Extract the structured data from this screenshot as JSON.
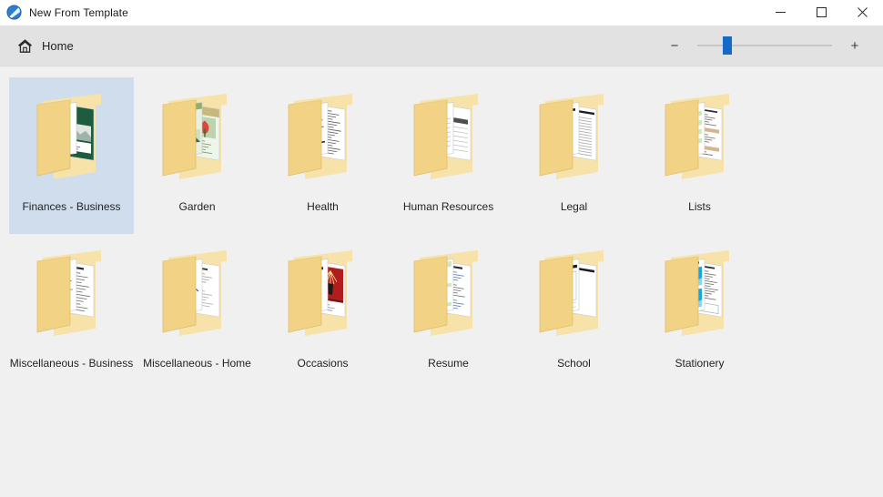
{
  "window": {
    "title": "New From Template",
    "app_icon": "document-globe-icon",
    "controls": {
      "minimize": "minimize-icon",
      "maximize": "maximize-icon",
      "close": "close-icon"
    }
  },
  "toolbar": {
    "home_label": "Home",
    "home_icon": "home-icon",
    "zoom_out_label": "−",
    "zoom_in_label": "+",
    "zoom_value": 20,
    "accent_color": "#1569c7"
  },
  "colors": {
    "titlebar_bg": "#ffffff",
    "toolbar_bg": "#e2e2e2",
    "content_bg": "#f0f0f0",
    "selection_bg": "#cfdded",
    "folder_front": "#f3d98b",
    "folder_back": "#f7e3a9",
    "text": "#232323"
  },
  "main": {
    "items": [
      {
        "label": "Finances - Business",
        "icon": "folder-templates-icon",
        "style": "finance",
        "selected": true
      },
      {
        "label": "Garden",
        "icon": "folder-templates-icon",
        "style": "garden",
        "selected": false
      },
      {
        "label": "Health",
        "icon": "folder-templates-icon",
        "style": "health",
        "selected": false
      },
      {
        "label": "Human Resources",
        "icon": "folder-templates-icon",
        "style": "hr",
        "selected": false
      },
      {
        "label": "Legal",
        "icon": "folder-templates-icon",
        "style": "legal",
        "selected": false
      },
      {
        "label": "Lists",
        "icon": "folder-templates-icon",
        "style": "lists",
        "selected": false
      },
      {
        "label": "Miscellaneous - Business",
        "icon": "folder-templates-icon",
        "style": "miscbiz",
        "selected": false
      },
      {
        "label": "Miscellaneous - Home",
        "icon": "folder-templates-icon",
        "style": "mischome",
        "selected": false
      },
      {
        "label": "Occasions",
        "icon": "folder-templates-icon",
        "style": "occasions",
        "selected": false
      },
      {
        "label": "Resume",
        "icon": "folder-templates-icon",
        "style": "resume",
        "selected": false
      },
      {
        "label": "School",
        "icon": "folder-templates-icon",
        "style": "school",
        "selected": false
      },
      {
        "label": "Stationery",
        "icon": "folder-templates-icon",
        "style": "stationery",
        "selected": false
      }
    ]
  }
}
